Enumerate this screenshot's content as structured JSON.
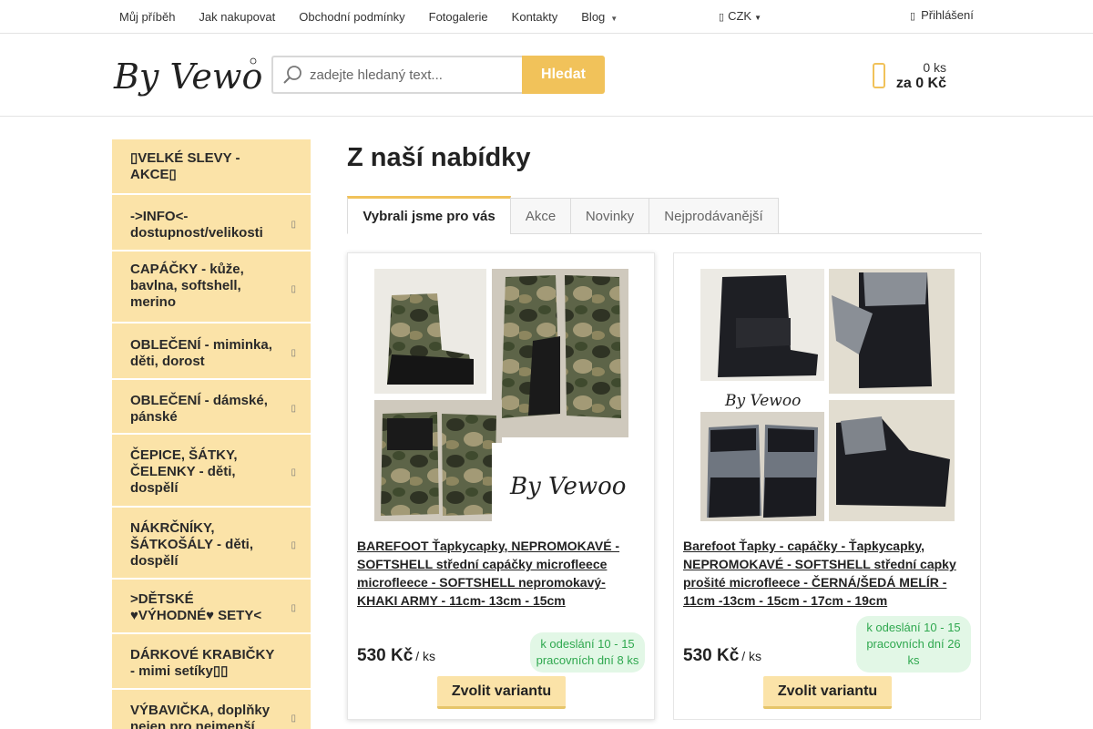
{
  "top_nav": {
    "items": [
      {
        "label": "Můj příběh"
      },
      {
        "label": "Jak nakupovat"
      },
      {
        "label": "Obchodní podmínky"
      },
      {
        "label": "Fotogalerie"
      },
      {
        "label": "Kontakty"
      },
      {
        "label": "Blog"
      }
    ],
    "currency": "CZK",
    "login": "Přihlášení"
  },
  "header": {
    "logo_text": "By Vewoo",
    "search_placeholder": "zadejte hledaný text...",
    "search_button": "Hledat",
    "cart_count": "0 ks",
    "cart_total": "za 0 Kč"
  },
  "sidebar": {
    "categories": [
      {
        "label": "VELKÉ SLEVY - AKCE",
        "has_arrow": false
      },
      {
        "label": "->INFO<- dostupnost/velikosti",
        "has_arrow": true
      },
      {
        "label": "CAPÁČKY - kůže, bavlna, softshell, merino",
        "has_arrow": true
      },
      {
        "label": "OBLEČENÍ - miminka, děti, dorost",
        "has_arrow": true
      },
      {
        "label": "OBLEČENÍ - dámské, pánské",
        "has_arrow": true
      },
      {
        "label": "ČEPICE, ŠÁTKY, ČELENKY - děti, dospělí",
        "has_arrow": true
      },
      {
        "label": "NÁKRČNÍKY, ŠÁTKOŠÁLY - děti, dospělí",
        "has_arrow": true
      },
      {
        "label": ">DĚTSKÉ ♥VÝHODNÉ♥ SETY<",
        "has_arrow": true
      },
      {
        "label": "DÁRKOVÉ KRABIČKY - mimi setíky",
        "has_arrow": false
      },
      {
        "label": "VÝBAVIČKA, doplňky nejen pro nejmenší",
        "has_arrow": true
      }
    ]
  },
  "main": {
    "title": "Z naší nabídky",
    "tabs": [
      {
        "label": "Vybrali jsme pro vás",
        "active": true
      },
      {
        "label": "Akce",
        "active": false
      },
      {
        "label": "Novinky",
        "active": false
      },
      {
        "label": "Nejprodávanější",
        "active": false
      }
    ],
    "products": [
      {
        "name": "BAREFOOT Ťapkycapky, NEPROMOKAVÉ - SOFTSHELL střední capáčky microfleece microfleece - SOFTSHELL nepromokavý- KHAKI ARMY - 11cm- 13cm - 15cm",
        "price": "530 Kč",
        "unit": "/ ks",
        "availability": "k odeslání 10 - 15 pracovních dní 8 ks",
        "button": "Zvolit variantu",
        "image_logo": "By Vewoo"
      },
      {
        "name": "Barefoot Ťapky - capáčky - Ťapkycapky, NEPROMOKAVÉ - SOFTSHELL střední capky prošité microfleece - ČERNÁ/ŠEDÁ MELÍR - 11cm -13cm - 15cm - 17cm - 19cm",
        "price": "530 Kč",
        "unit": "/ ks",
        "availability": "k odeslání 10 - 15 pracovních dní 26 ks",
        "button": "Zvolit variantu",
        "image_logo": "By Vewoo"
      }
    ]
  },
  "colors": {
    "accent": "#f1c25a",
    "sidebar_bg": "#fbe3a8",
    "availability_bg": "#e2f7e6",
    "availability_text": "#2fa84f"
  }
}
